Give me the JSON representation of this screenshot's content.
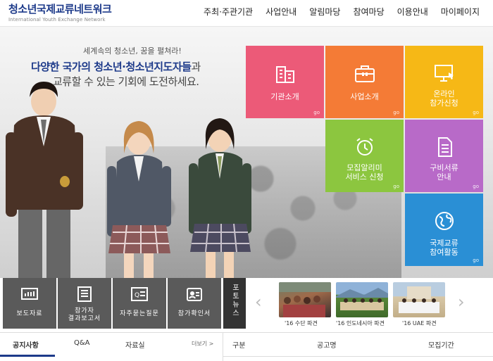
{
  "brand": {
    "name": "청소년국제교류네트워크",
    "tagline": "International Youth Exchange Network",
    "accent": "#1d3a8a"
  },
  "nav": {
    "items": [
      {
        "label": "주최·주관기관"
      },
      {
        "label": "사업안내"
      },
      {
        "label": "알림마당"
      },
      {
        "label": "참여마당"
      },
      {
        "label": "이용안내"
      },
      {
        "label": "마이페이지"
      }
    ]
  },
  "hero": {
    "subtitle": "세계속의 청소년, 꿈을 펼쳐라!",
    "title_main": "다양한 국가의 청소년·청소년지도자들",
    "title_tail": "과",
    "line2": "교류할 수 있는 기회에 도전하세요."
  },
  "tiles": [
    {
      "label": "기관소개",
      "icon": "building-icon",
      "color": "#ec5a78",
      "go": "go"
    },
    {
      "label": "사업소개",
      "icon": "briefcase-icon",
      "color": "#f47b36",
      "go": "go"
    },
    {
      "label": "온라인\n참가신청",
      "icon": "monitor-cursor-icon",
      "color": "#f6b816",
      "go": "go"
    },
    {
      "label": "모집알리미\n서비스 신청",
      "icon": "alarm-clock-icon",
      "color": "#8cc63f",
      "go": "go"
    },
    {
      "label": "구비서류\n안내",
      "icon": "document-icon",
      "color": "#b86ac8",
      "go": "go"
    },
    {
      "label": "국제교류\n참여활동",
      "icon": "globe-icon",
      "color": "#2a8fd5",
      "go": "go"
    }
  ],
  "quick": [
    {
      "label": "보도자료",
      "icon": "chart-icon"
    },
    {
      "label": "참가자\n결과보고서",
      "icon": "report-icon"
    },
    {
      "label": "자주묻는질문",
      "icon": "faq-icon"
    },
    {
      "label": "참가확인서",
      "icon": "id-badge-icon"
    }
  ],
  "photo_news": {
    "label": "포토뉴스",
    "items": [
      {
        "caption": "'16 수단 파견"
      },
      {
        "caption": "'16 인도네시아 파견"
      },
      {
        "caption": "'16 UAE 파견"
      }
    ]
  },
  "board": {
    "tabs": [
      {
        "label": "공지사항"
      },
      {
        "label": "Q&A"
      },
      {
        "label": "자료실"
      }
    ],
    "more": "더보기 >",
    "columns": [
      "구분",
      "공고명",
      "모집기간"
    ]
  }
}
